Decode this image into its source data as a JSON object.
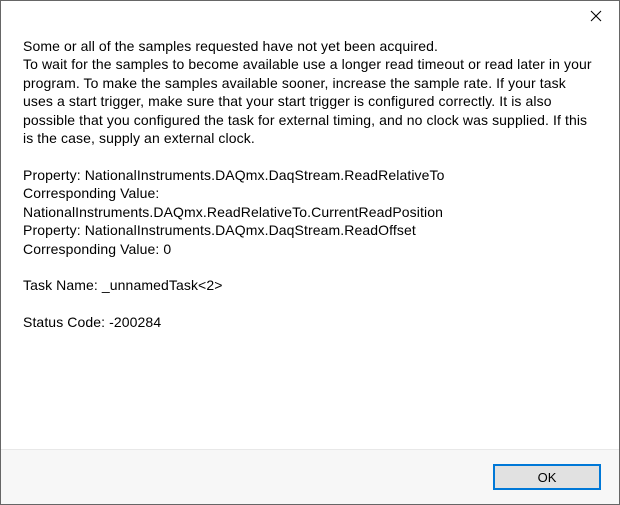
{
  "dialog": {
    "close_icon": "close-icon",
    "message": "Some or all of the samples requested have not yet been acquired.\nTo wait for the samples to become available use a longer read timeout or read later in your program. To make the samples available sooner, increase the sample rate. If your task uses a start trigger,  make sure that your start trigger is configured correctly. It is also possible that you configured the task for external timing, and no clock was supplied. If this is the case, supply an external clock.",
    "properties": {
      "line1": "Property: NationalInstruments.DAQmx.DaqStream.ReadRelativeTo",
      "line2": "Corresponding Value:",
      "line3": "NationalInstruments.DAQmx.ReadRelativeTo.CurrentReadPosition",
      "line4": "Property: NationalInstruments.DAQmx.DaqStream.ReadOffset",
      "line5": "Corresponding Value: 0"
    },
    "task_name_line": "Task Name: _unnamedTask<2>",
    "status_code_line": "Status Code: -200284",
    "ok_label": "OK"
  }
}
